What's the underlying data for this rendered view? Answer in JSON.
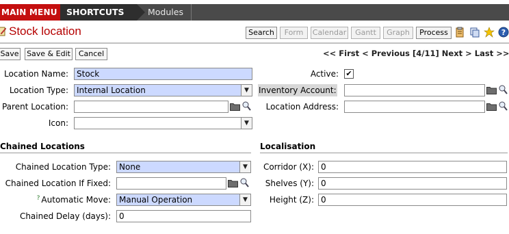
{
  "nav": {
    "main_menu": "MAIN MENU",
    "shortcuts": "SHORTCUTS",
    "modules": "Modules"
  },
  "header": {
    "title": "Stock location",
    "buttons": {
      "search": "Search",
      "form": "Form",
      "calendar": "Calendar",
      "gantt": "Gantt",
      "graph": "Graph",
      "process": "Process"
    }
  },
  "actions": {
    "save": "Save",
    "save_edit": "Save & Edit",
    "cancel": "Cancel"
  },
  "pager": {
    "first": "<< First",
    "previous": "< Previous",
    "position": "[4/11]",
    "next": "Next >",
    "last": "Last >>"
  },
  "form": {
    "location_name": {
      "label": "Location Name:",
      "value": "Stock"
    },
    "location_type": {
      "label": "Location Type:",
      "value": "Internal Location"
    },
    "parent_location": {
      "label": "Parent Location:",
      "value": ""
    },
    "icon": {
      "label": "Icon:",
      "value": ""
    },
    "active": {
      "label": "Active:",
      "checked": true,
      "mark": "✔"
    },
    "inventory_account": {
      "label": "Inventory Account:",
      "value": ""
    },
    "location_address": {
      "label": "Location Address:",
      "value": ""
    }
  },
  "chained": {
    "title": "Chained Locations",
    "type": {
      "label": "Chained Location Type:",
      "value": "None"
    },
    "if_fixed": {
      "label": "Chained Location If Fixed:",
      "value": ""
    },
    "auto_move": {
      "label": "Automatic Move:",
      "help_mark": "?",
      "value": "Manual Operation"
    },
    "delay": {
      "label": "Chained Delay (days):",
      "value": "0"
    }
  },
  "localisation": {
    "title": "Localisation",
    "corridor": {
      "label": "Corridor (X):",
      "value": "0"
    },
    "shelves": {
      "label": "Shelves (Y):",
      "value": "0"
    },
    "height": {
      "label": "Height (Z):",
      "value": "0"
    }
  },
  "colors": {
    "required_field": "#ccd9ff",
    "main_menu_bg": "#c40f0f",
    "title_red": "#b50000"
  },
  "icons": {
    "dropdown": "▼",
    "folder": "folder-icon",
    "search": "magnifier-icon"
  }
}
